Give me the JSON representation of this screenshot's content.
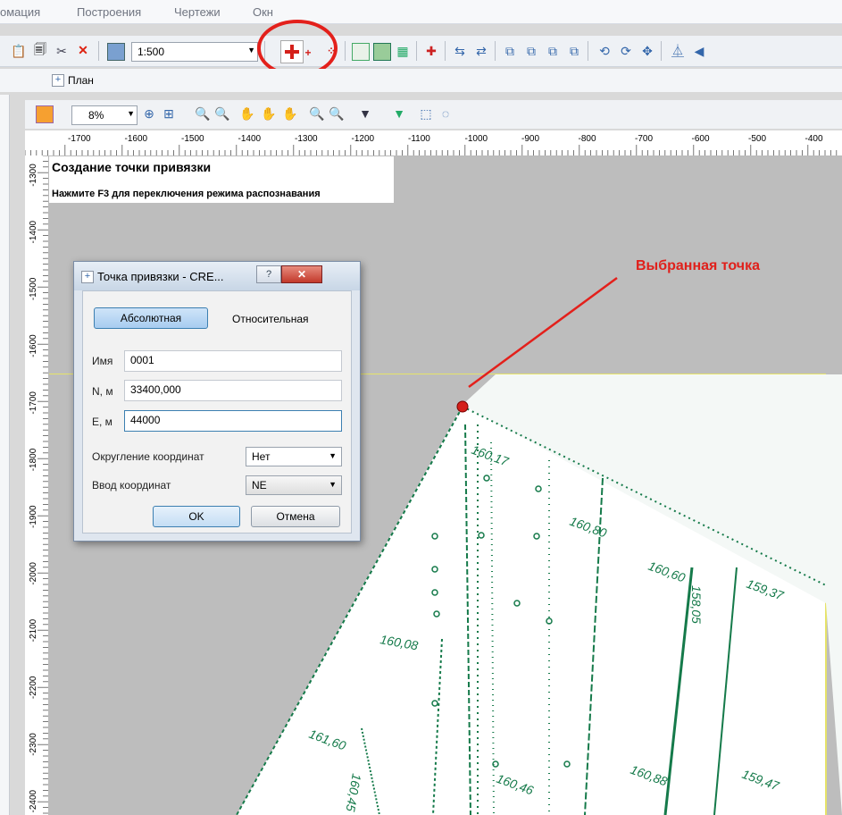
{
  "menu": [
    "омация",
    "Построения",
    "Чертежи",
    "Окн"
  ],
  "toolbar": {
    "scale_value": "1:500"
  },
  "plan_tab": {
    "label": "План"
  },
  "map_toolbar": {
    "zoom_value": "8%"
  },
  "ruler": {
    "h": [
      "-1700",
      "-1600",
      "-1500",
      "-1400",
      "-1300",
      "-1200",
      "-1100",
      "-1000",
      "-900",
      "-800",
      "-700",
      "-600",
      "-500",
      "-400"
    ],
    "v": [
      "-1300",
      "-1400",
      "-1500",
      "-1600",
      "-1700",
      "-1800",
      "-1900",
      "-2000",
      "-2100",
      "-2200",
      "-2300",
      "-2400"
    ]
  },
  "hint": {
    "title": "Создание точки привязки",
    "subtitle": "Нажмите F3 для переключения режима распознавания"
  },
  "annotation": {
    "label": "Выбранная точка",
    "color": "#e0201b"
  },
  "dialog": {
    "title": "Точка привязки - CRE...",
    "tab_absolute": "Абсолютная",
    "tab_relative": "Относительная",
    "name_label": "Имя",
    "name_value": "0001",
    "n_label": "N, м",
    "n_value": "33400,000",
    "e_label": "E, м",
    "e_value": "44000",
    "rounding_label": "Округление координат",
    "rounding_value": "Нет",
    "input_label": "Ввод координат",
    "input_value": "NE",
    "ok": "OK",
    "cancel": "Отмена"
  },
  "scan_labels": [
    "160,17",
    "160,80",
    "160,60",
    "159,37",
    "158,05",
    "160,08",
    "160,88",
    "159,47",
    "160,46",
    "160,45",
    "161,60"
  ]
}
